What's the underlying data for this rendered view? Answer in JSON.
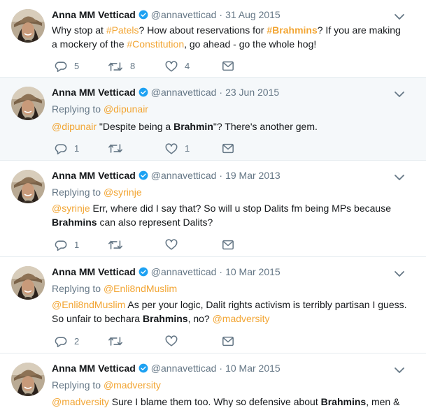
{
  "author": {
    "name": "Anna MM Vetticad",
    "handle": "@annavetticad",
    "verified_color": "#1da1f2"
  },
  "colors": {
    "link": "#f2a533",
    "muted": "#657786",
    "highlight_bg": "#f5f8fa"
  },
  "tweets": [
    {
      "date": "31 Aug 2015",
      "text": {
        "p1": "Why stop at ",
        "h1": "#Patels",
        "p2": "? How about reservations for ",
        "h2": "#Brahmins",
        "p3": "? If you are making a mockery of the ",
        "h3": "#Constitution",
        "p4": ", go ahead - go the whole hog!"
      },
      "replies": "5",
      "retweets": "8",
      "likes": "4"
    },
    {
      "date": "23 Jun 2015",
      "replying_label": "Replying to",
      "replying_to": "@dipunair",
      "text": {
        "m1": "@dipunair",
        "p1": " \"Despite being a ",
        "b1": "Brahmin",
        "p2": "\"? There's another gem."
      },
      "replies": "1",
      "retweets": "",
      "likes": "1"
    },
    {
      "date": "19 Mar 2013",
      "replying_label": "Replying to",
      "replying_to": "@syrinje",
      "text": {
        "m1": "@syrinje",
        "p1": " Err, where did I say that? So will u stop Dalits fm being MPs because ",
        "b1": "Brahmins",
        "p2": " can also represent Dalits?"
      },
      "replies": "1",
      "retweets": "",
      "likes": ""
    },
    {
      "date": "10 Mar 2015",
      "replying_label": "Replying to",
      "replying_to": "@Enli8ndMuslim",
      "text": {
        "m1": "@Enli8ndMuslim",
        "p1": " As per your logic, Dalit rights activism is terribly partisan I guess. So unfair to bechara ",
        "b1": "Brahmins",
        "p2": ", no? ",
        "m2": "@madversity"
      },
      "replies": "2",
      "retweets": "",
      "likes": ""
    },
    {
      "date": "10 Mar 2015",
      "replying_label": "Replying to",
      "replying_to": "@madversity",
      "text": {
        "m1": "@madversity",
        "p1": " Sure I blame them too. Why so defensive about ",
        "b1": "Brahmins",
        "p2": ", men &"
      }
    }
  ]
}
